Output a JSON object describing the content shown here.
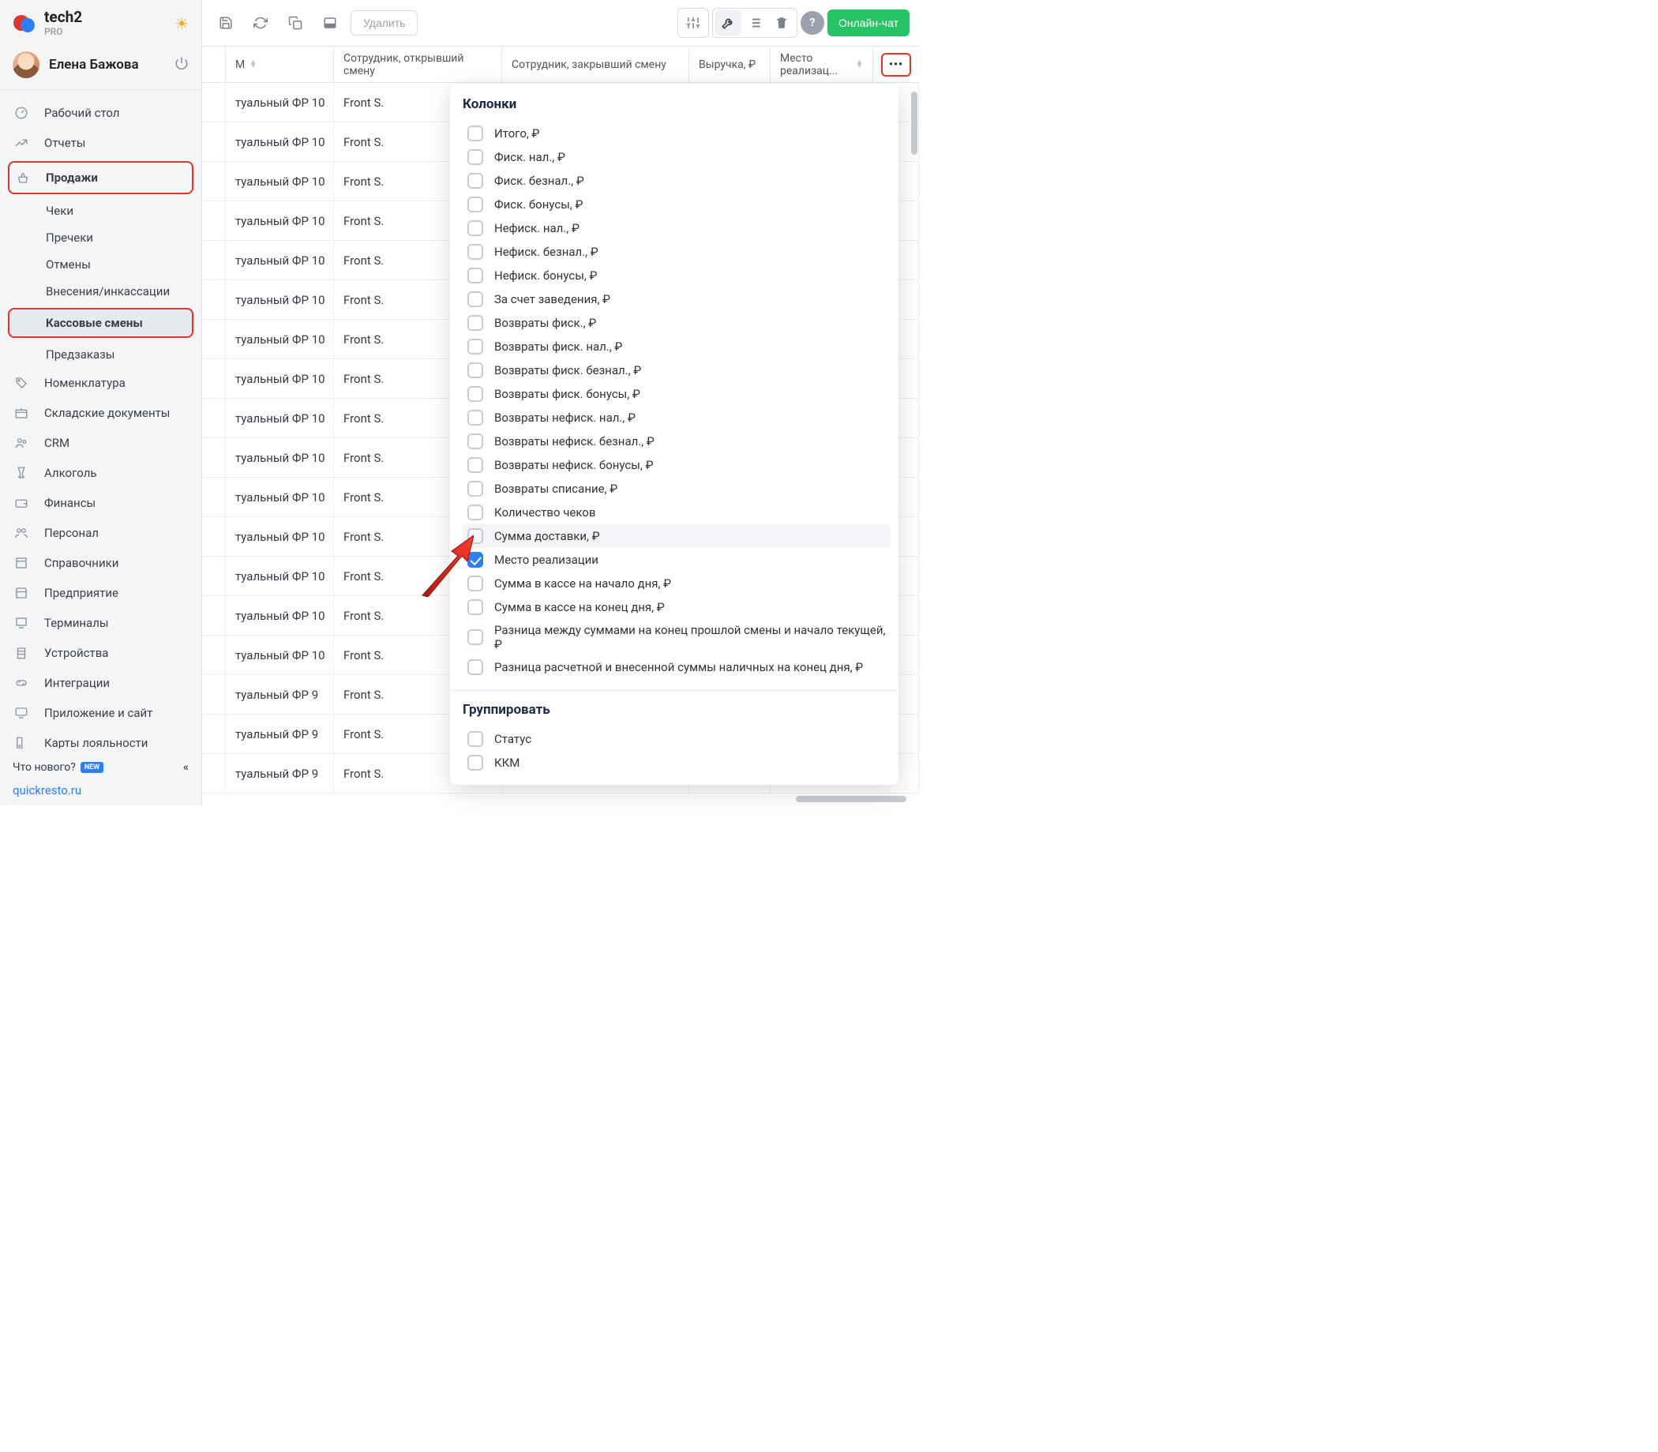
{
  "app": {
    "title": "tech2",
    "subtitle": "PRO"
  },
  "user": {
    "name": "Елена Бажова"
  },
  "sidebar": {
    "items": [
      {
        "label": "Рабочий стол",
        "icon": "gauge"
      },
      {
        "label": "Отчеты",
        "icon": "chart"
      },
      {
        "label": "Продажи",
        "icon": "basket",
        "highlight": true
      },
      {
        "label": "Чеки",
        "sub": true
      },
      {
        "label": "Пречеки",
        "sub": true
      },
      {
        "label": "Отмены",
        "sub": true
      },
      {
        "label": "Внесения/инкассации",
        "sub": true
      },
      {
        "label": "Кассовые смены",
        "sub": true,
        "highlight": true,
        "selected": true
      },
      {
        "label": "Предзаказы",
        "sub": true
      },
      {
        "label": "Номенклатура",
        "icon": "tag"
      },
      {
        "label": "Складские документы",
        "icon": "box"
      },
      {
        "label": "CRM",
        "icon": "people"
      },
      {
        "label": "Алкоголь",
        "icon": "glass"
      },
      {
        "label": "Финансы",
        "icon": "wallet"
      },
      {
        "label": "Персонал",
        "icon": "users"
      },
      {
        "label": "Справочники",
        "icon": "book"
      },
      {
        "label": "Предприятие",
        "icon": "store"
      },
      {
        "label": "Терминалы",
        "icon": "terminal"
      },
      {
        "label": "Устройства",
        "icon": "printer"
      },
      {
        "label": "Интеграции",
        "icon": "link"
      },
      {
        "label": "Приложение и сайт",
        "icon": "monitor"
      },
      {
        "label": "Карты лояльности",
        "icon": "card"
      }
    ],
    "whats_new": "Что нового?",
    "badge": "NEW",
    "footer_link": "quickresto.ru"
  },
  "toolbar": {
    "delete": "Удалить",
    "chat": "Онлайн-чат"
  },
  "table": {
    "headers": {
      "c0": "",
      "c1": "М",
      "c2": "Сотрудник, открывший смену",
      "c3": "Сотрудник, закрывший смену",
      "c4": "Выручка, ₽",
      "c5": "Место реализац..."
    },
    "rows": [
      {
        "c1": "туальный ФР 10",
        "c2": "Front S."
      },
      {
        "c1": "туальный ФР 10",
        "c2": "Front S."
      },
      {
        "c1": "туальный ФР 10",
        "c2": "Front S."
      },
      {
        "c1": "туальный ФР 10",
        "c2": "Front S."
      },
      {
        "c1": "туальный ФР 10",
        "c2": "Front S."
      },
      {
        "c1": "туальный ФР 10",
        "c2": "Front S."
      },
      {
        "c1": "туальный ФР 10",
        "c2": "Front S."
      },
      {
        "c1": "туальный ФР 10",
        "c2": "Front S."
      },
      {
        "c1": "туальный ФР 10",
        "c2": "Front S."
      },
      {
        "c1": "туальный ФР 10",
        "c2": "Front S."
      },
      {
        "c1": "туальный ФР 10",
        "c2": "Front S."
      },
      {
        "c1": "туальный ФР 10",
        "c2": "Front S."
      },
      {
        "c1": "туальный ФР 10",
        "c2": "Front S."
      },
      {
        "c1": "туальный ФР 10",
        "c2": "Front S."
      },
      {
        "c1": "туальный ФР 10",
        "c2": "Front S."
      },
      {
        "c1": "туальный ФР 9",
        "c2": "Front S."
      },
      {
        "c1": "туальный ФР 9",
        "c2": "Front S."
      },
      {
        "c1": "туальный ФР 9",
        "c2": "Front S."
      }
    ]
  },
  "dropdown": {
    "title_columns": "Колонки",
    "title_group": "Группировать",
    "columns": [
      {
        "label": "Итого, ₽"
      },
      {
        "label": "Фиск. нал., ₽"
      },
      {
        "label": "Фиск. безнал., ₽"
      },
      {
        "label": "Фиск. бонусы, ₽"
      },
      {
        "label": "Нефиск. нал., ₽"
      },
      {
        "label": "Нефиск. безнал., ₽"
      },
      {
        "label": "Нефиск. бонусы, ₽"
      },
      {
        "label": "За счет заведения, ₽"
      },
      {
        "label": "Возвраты фиск., ₽"
      },
      {
        "label": "Возвраты фиск. нал., ₽"
      },
      {
        "label": "Возвраты фиск. безнал., ₽"
      },
      {
        "label": "Возвраты фиск. бонусы, ₽"
      },
      {
        "label": "Возвраты нефиск. нал., ₽"
      },
      {
        "label": "Возвраты нефиск. безнал., ₽"
      },
      {
        "label": "Возвраты нефиск. бонусы, ₽"
      },
      {
        "label": "Возвраты списание, ₽"
      },
      {
        "label": "Количество чеков"
      },
      {
        "label": "Сумма доставки, ₽",
        "hover": true
      },
      {
        "label": "Место реализации",
        "checked": true
      },
      {
        "label": "Сумма в кассе на начало дня, ₽"
      },
      {
        "label": "Сумма в кассе на конец дня, ₽"
      },
      {
        "label": "Разница между суммами на конец прошлой смены и начало текущей, ₽"
      },
      {
        "label": "Разница расчетной и внесенной суммы наличных на конец дня, ₽"
      }
    ],
    "groups": [
      {
        "label": "Статус"
      },
      {
        "label": "ККМ"
      }
    ]
  }
}
